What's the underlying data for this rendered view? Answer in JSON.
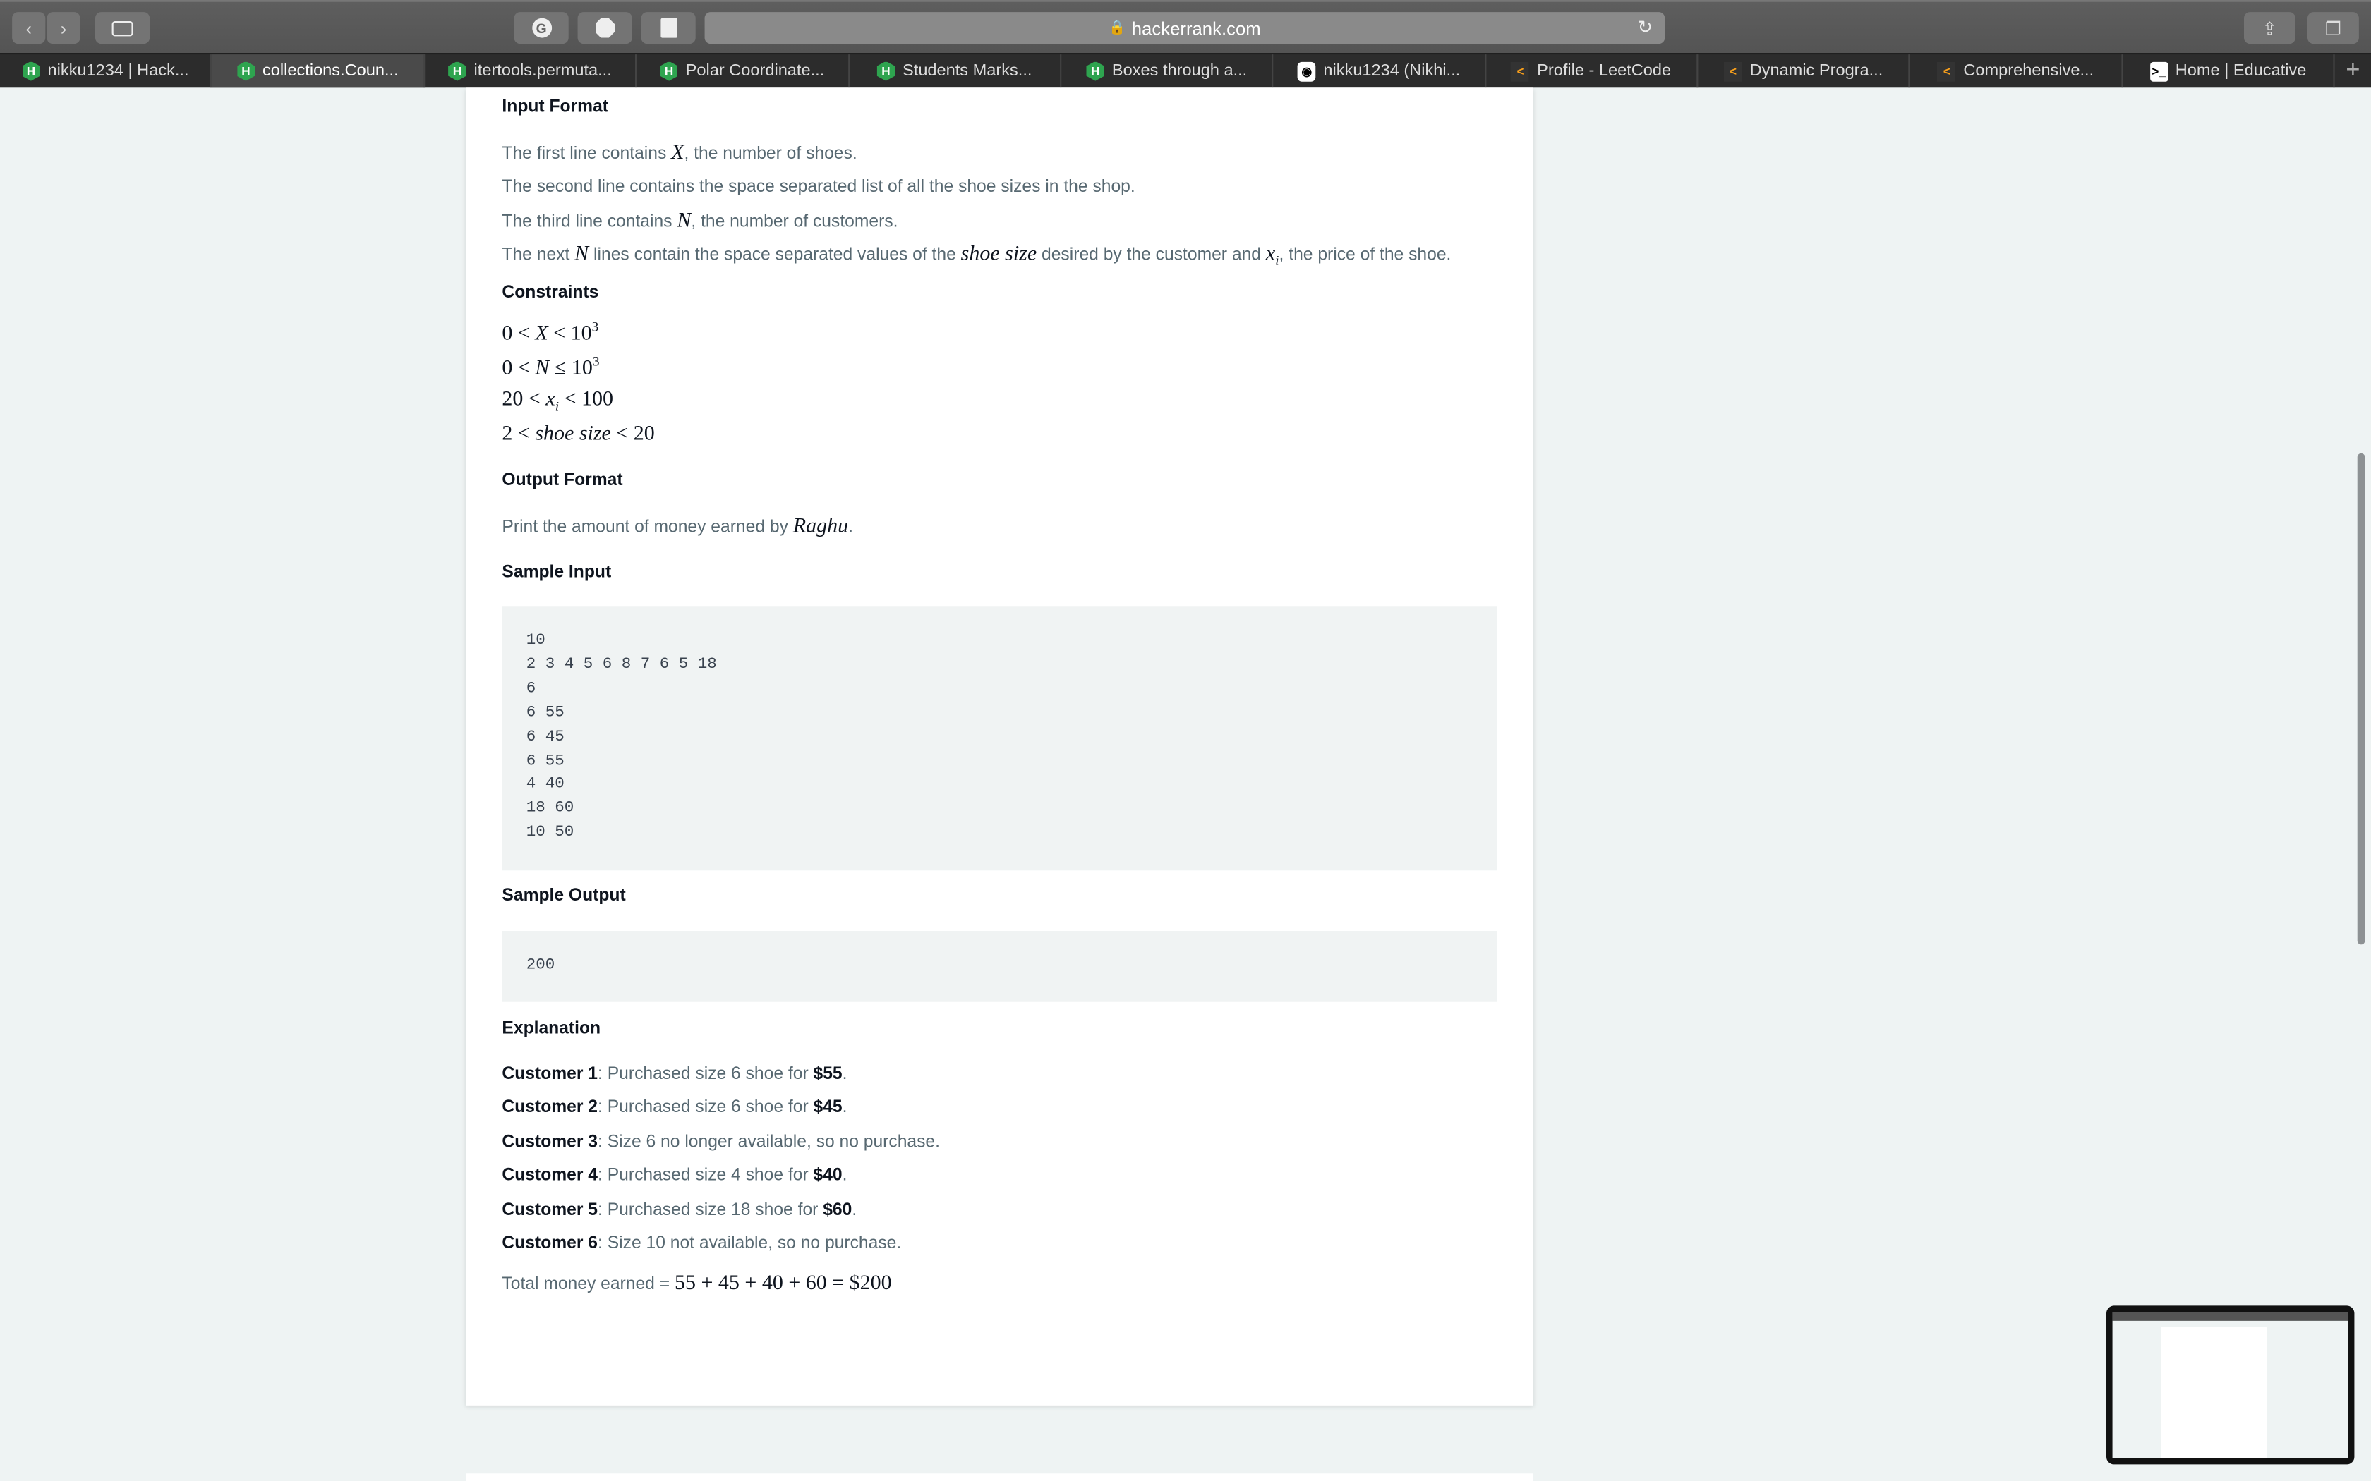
{
  "browser": {
    "url": "hackerrank.com",
    "toolbar_icons": [
      "back-icon",
      "forward-icon",
      "sidebar-icon",
      "grammarly-icon",
      "adblock-icon",
      "todo-icon",
      "lock-icon",
      "reload-icon",
      "share-icon",
      "tabs-overview-icon"
    ]
  },
  "tabs": [
    {
      "label": "nikku1234 | Hack...",
      "icon": "H",
      "kind": "hr"
    },
    {
      "label": "collections.Coun...",
      "icon": "H",
      "kind": "hr",
      "active": true
    },
    {
      "label": "itertools.permuta...",
      "icon": "H",
      "kind": "hr"
    },
    {
      "label": "Polar Coordinate...",
      "icon": "H",
      "kind": "hr"
    },
    {
      "label": "Students Marks...",
      "icon": "H",
      "kind": "hr"
    },
    {
      "label": "Boxes through a...",
      "icon": "H",
      "kind": "hr"
    },
    {
      "label": "nikku1234 (Nikhi...",
      "icon": "◉",
      "kind": "gh"
    },
    {
      "label": "Profile - LeetCode",
      "icon": "<",
      "kind": "lc"
    },
    {
      "label": "Dynamic Progra...",
      "icon": "<",
      "kind": "lc"
    },
    {
      "label": "Comprehensive...",
      "icon": "<",
      "kind": "lc"
    },
    {
      "label": "Home | Educative",
      "icon": ">_",
      "kind": "ed"
    }
  ],
  "tab_plus": "+",
  "problem": {
    "input_format": {
      "heading": "Input Format",
      "line1_a": "The first line contains ",
      "line1_m": "X",
      "line1_b": ", the number of shoes.",
      "line2": "The second line contains the space separated list of all the shoe sizes in the shop.",
      "line3_a": "The third line contains ",
      "line3_m": "N",
      "line3_b": ", the number of customers.",
      "line4_a": "The next ",
      "line4_m": "N",
      "line4_b": " lines contain the space separated values of the ",
      "line4_m2": "shoe size",
      "line4_c": " desired by the customer and ",
      "line4_m3": "x",
      "line4_sub": "i",
      "line4_d": ", the price of the shoe."
    },
    "constraints": {
      "heading": "Constraints",
      "items": [
        "0 < X < 10",
        "0 < N ≤ 10",
        "20 < x",
        "2 < shoe size < 20"
      ],
      "c1": "0 < ",
      "c1m": "X",
      "c1b": " < 10",
      "c1s": "3",
      "c2": "0 < ",
      "c2m": "N",
      "c2b": " ≤ 10",
      "c2s": "3",
      "c3": "20 < ",
      "c3m": "x",
      "c3sub": "i",
      "c3b": " < 100",
      "c4": "2 < ",
      "c4m": "shoe size",
      "c4b": " < 20"
    },
    "output_format": {
      "heading": "Output Format",
      "text": "Print the amount of money earned by ",
      "name": "Raghu",
      "end": "."
    },
    "sample_input": {
      "heading": "Sample Input",
      "code": "10\n2 3 4 5 6 8 7 6 5 18\n6\n6 55\n6 45\n6 55\n4 40\n18 60\n10 50"
    },
    "sample_output": {
      "heading": "Sample Output",
      "code": "200"
    },
    "explanation": {
      "heading": "Explanation",
      "customers": [
        {
          "name": "Customer 1",
          "text": ": Purchased size 6 shoe for ",
          "price": "$55",
          "end": "."
        },
        {
          "name": "Customer 2",
          "text": ": Purchased size 6 shoe for ",
          "price": "$45",
          "end": "."
        },
        {
          "name": "Customer 3",
          "text": ": Size 6 no longer available, so no purchase.",
          "price": "",
          "end": ""
        },
        {
          "name": "Customer 4",
          "text": ": Purchased size 4 shoe for ",
          "price": "$40",
          "end": "."
        },
        {
          "name": "Customer 5",
          "text": ": Purchased size 18 shoe for ",
          "price": "$60",
          "end": "."
        },
        {
          "name": "Customer 6",
          "text": ": Size 10 not available, so no purchase.",
          "price": "",
          "end": ""
        }
      ],
      "total_label": "Total money earned = ",
      "total_math": "55 + 45 + 40 + 60 =  $200"
    }
  }
}
